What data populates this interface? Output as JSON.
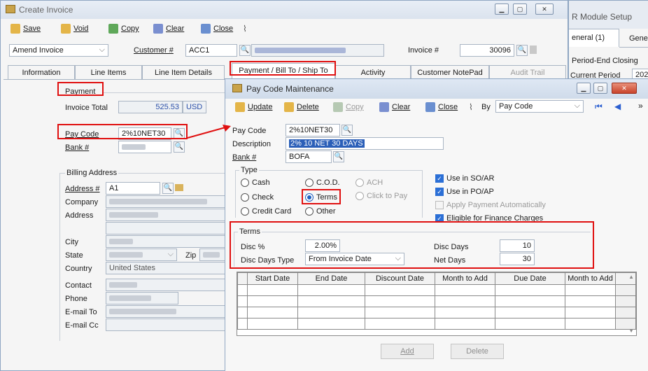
{
  "create_invoice": {
    "title": "Create Invoice",
    "toolbar": {
      "save": "Save",
      "void": "Void",
      "copy": "Copy",
      "clear": "Clear",
      "close": "Close"
    },
    "mode": "Amend Invoice",
    "customer_label": "Customer #",
    "customer_value": "ACC1",
    "invoice_label": "Invoice #",
    "invoice_value": "30096",
    "tabs": [
      "Information",
      "Line Items",
      "Line Item Details",
      "Payment / Bill To / Ship To",
      "Activity",
      "Customer NotePad",
      "Audit Trail"
    ],
    "payment_heading": "Payment",
    "invoice_total_label": "Invoice Total",
    "invoice_total_value": "525.53",
    "currency": "USD",
    "pay_code_label": "Pay Code",
    "pay_code_value": "2%10NET30",
    "bank_label": "Bank #",
    "billing_heading": "Billing Address",
    "address_no_label": "Address #",
    "address_no_value": "A1",
    "company_label": "Company",
    "address_label": "Address",
    "city_label": "City",
    "state_label": "State",
    "zip_label": "Zip",
    "country_label": "Country",
    "country_value": "United States",
    "contact_label": "Contact",
    "phone_label": "Phone",
    "email_to_label": "E-mail To",
    "email_cc_label": "E-mail Cc"
  },
  "module_setup": {
    "title": "R Module Setup",
    "tabs": [
      "eneral (1)",
      "Gene"
    ],
    "section": "Period-End Closing",
    "current_period_label": "Current Period",
    "current_period_value": "202"
  },
  "pay_code_maint": {
    "title": "Pay Code Maintenance",
    "toolbar": {
      "update": "Update",
      "delete": "Delete",
      "copy": "Copy",
      "clear": "Clear",
      "close": "Close",
      "by": "By",
      "by_value": "Pay Code"
    },
    "pay_code_label": "Pay Code",
    "pay_code_value": "2%10NET30",
    "description_label": "Description",
    "description_value": "2% 10 NET 30 DAYS",
    "bank_label": "Bank #",
    "bank_value": "BOFA",
    "type_heading": "Type",
    "types": {
      "cash": "Cash",
      "cod": "C.O.D.",
      "ach": "ACH",
      "check": "Check",
      "terms": "Terms",
      "click_to_pay": "Click to Pay",
      "credit_card": "Credit Card",
      "other": "Other"
    },
    "checks": {
      "so_ar": "Use in SO/AR",
      "po_ap": "Use in PO/AP",
      "apply": "Apply Payment Automatically",
      "finance": "Eligible for Finance Charges"
    },
    "terms_heading": "Terms",
    "disc_pct_label": "Disc %",
    "disc_pct_value": "2.00%",
    "disc_days_type_label": "Disc Days Type",
    "disc_days_type_value": "From Invoice Date",
    "disc_days_label": "Disc Days",
    "disc_days_value": "10",
    "net_days_label": "Net Days",
    "net_days_value": "30",
    "grid_columns": [
      "Start Date",
      "End Date",
      "Discount Date",
      "Month to Add",
      "Due Date",
      "Month to Add"
    ],
    "add": "Add",
    "delete_btn": "Delete"
  }
}
